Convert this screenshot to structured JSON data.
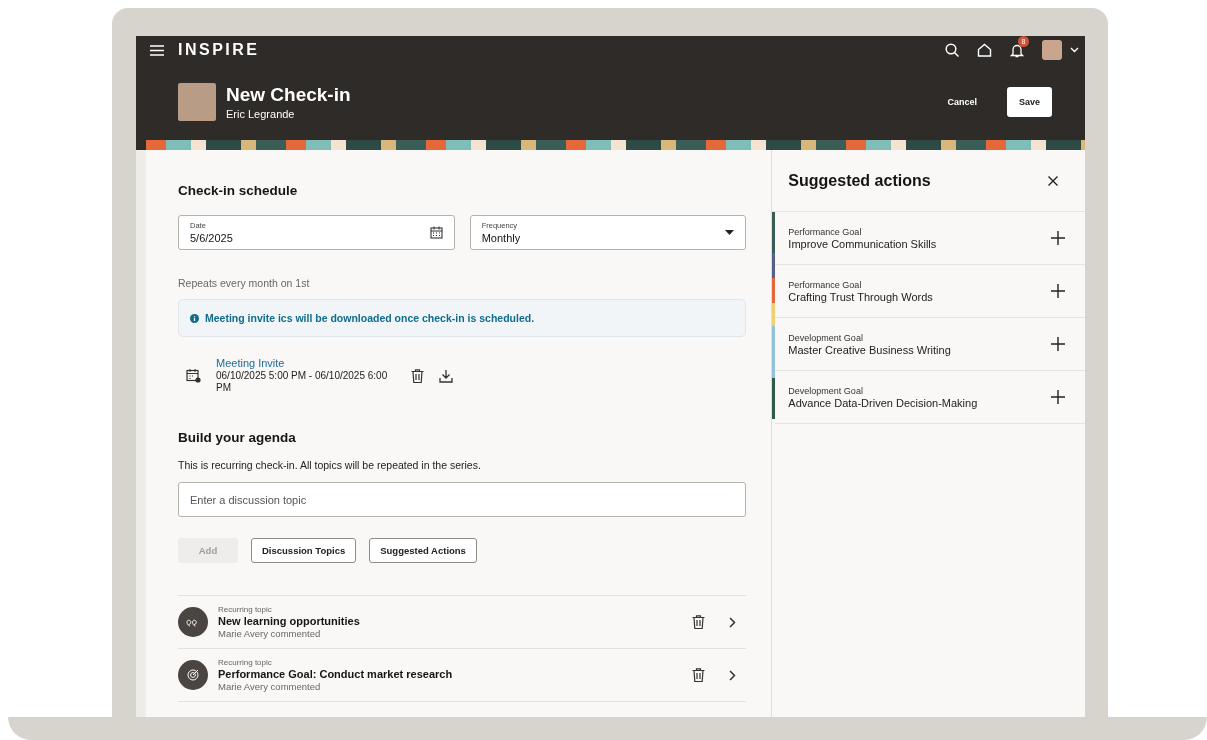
{
  "app": {
    "logo": "INSPIRE",
    "notification_count": "8"
  },
  "header": {
    "title": "New Check-in",
    "subtitle": "Eric Legrande",
    "buttons": [
      {
        "label": "Cancel",
        "kind": "text"
      },
      {
        "label": "Save",
        "kind": "solid"
      }
    ]
  },
  "schedule": {
    "heading": "Check-in schedule",
    "date": {
      "label": "Date",
      "value": "5/6/2025"
    },
    "frequency": {
      "label": "Frequency",
      "value": "Monthly"
    },
    "repeat_note": "Repeats every month on 1st",
    "info": "Meeting invite ics will be downloaded once check-in is scheduled.",
    "invite": {
      "title": "Meeting Invite",
      "time": "06/10/2025 5:00 PM - 06/10/2025 6:00 PM"
    }
  },
  "agenda": {
    "heading": "Build your agenda",
    "note": "This is recurring check-in. All topics will be repeated in the series.",
    "topic_field": {
      "placeholder": "Enter a discussion topic"
    },
    "buttons": [
      {
        "label": "Add",
        "disabled": true
      },
      {
        "label": "Discussion Topics",
        "disabled": false
      },
      {
        "label": "Suggested Actions",
        "disabled": false
      }
    ],
    "topics": [
      {
        "kind": "quote",
        "caption": "Recurring topic",
        "title": "New learning opportunities",
        "meta": "Marie Avery commented"
      },
      {
        "kind": "goal",
        "caption": "Recurring topic",
        "title": "Performance Goal: Conduct market research",
        "meta": "Marie Avery commented"
      }
    ]
  },
  "side_panel": {
    "title": "Suggested actions",
    "actions": [
      {
        "category": "Performance Goal",
        "title": "Improve Communication Skills"
      },
      {
        "category": "Performance Goal",
        "title": "Crafting Trust Through Words"
      },
      {
        "category": "Development Goal",
        "title": "Master Creative Business Writing"
      },
      {
        "category": "Development Goal",
        "title": "Advance Data-Driven Decision-Making"
      }
    ]
  }
}
